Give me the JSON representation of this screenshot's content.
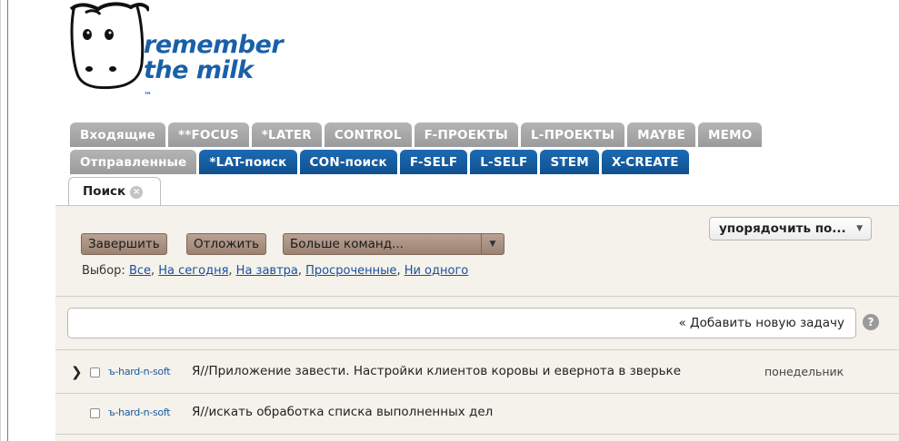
{
  "logo": {
    "line1": "remember",
    "line2": "the milk",
    "tm": "™"
  },
  "tabs_row1": [
    "Входящие",
    "**FOCUS",
    "*LATER",
    "CONTROL",
    "F-ПРОЕКТЫ",
    "L-ПРОЕКТЫ",
    "MAYBE",
    "MEMO"
  ],
  "tabs_row2": [
    {
      "label": "Отправленные",
      "style": "gray"
    },
    {
      "label": "*LAT-поиск",
      "style": "blue"
    },
    {
      "label": "CON-поиск",
      "style": "blue"
    },
    {
      "label": "F-SELF",
      "style": "blue"
    },
    {
      "label": "L-SELF",
      "style": "blue"
    },
    {
      "label": "STEM",
      "style": "blue"
    },
    {
      "label": "X-CREATE",
      "style": "blue"
    }
  ],
  "search_tab": {
    "label": "Поиск",
    "close": "×"
  },
  "toolbar": {
    "complete": "Завершить",
    "postpone": "Отложить",
    "more": "Больше команд...",
    "more_arrow": "▼",
    "sort": "упорядочить по...",
    "sort_arrow": "▼"
  },
  "selection": {
    "label": "Выбор:",
    "options": [
      "Все",
      "На сегодня",
      "На завтра",
      "Просроченные",
      "Ни одного"
    ]
  },
  "add_task": {
    "label": "« Добавить новую задачу",
    "help": "?"
  },
  "tasks": [
    {
      "chevron": "❯",
      "tag": "ъ-hard-n-soft",
      "name": "Я//Приложение завести. Настройки клиентов коровы и евернота в зверьке",
      "due": "понедельник"
    },
    {
      "chevron": "",
      "tag": "ъ-hard-n-soft",
      "name": "Я//искать обработка списка выполненных дел",
      "due": ""
    }
  ],
  "colors": {
    "tab_gray": "#a8a8a8",
    "tab_blue": "#155ea4",
    "button": "#ac9383",
    "link": "#1a4f9e",
    "panel_bg": "#f4f2ea"
  }
}
